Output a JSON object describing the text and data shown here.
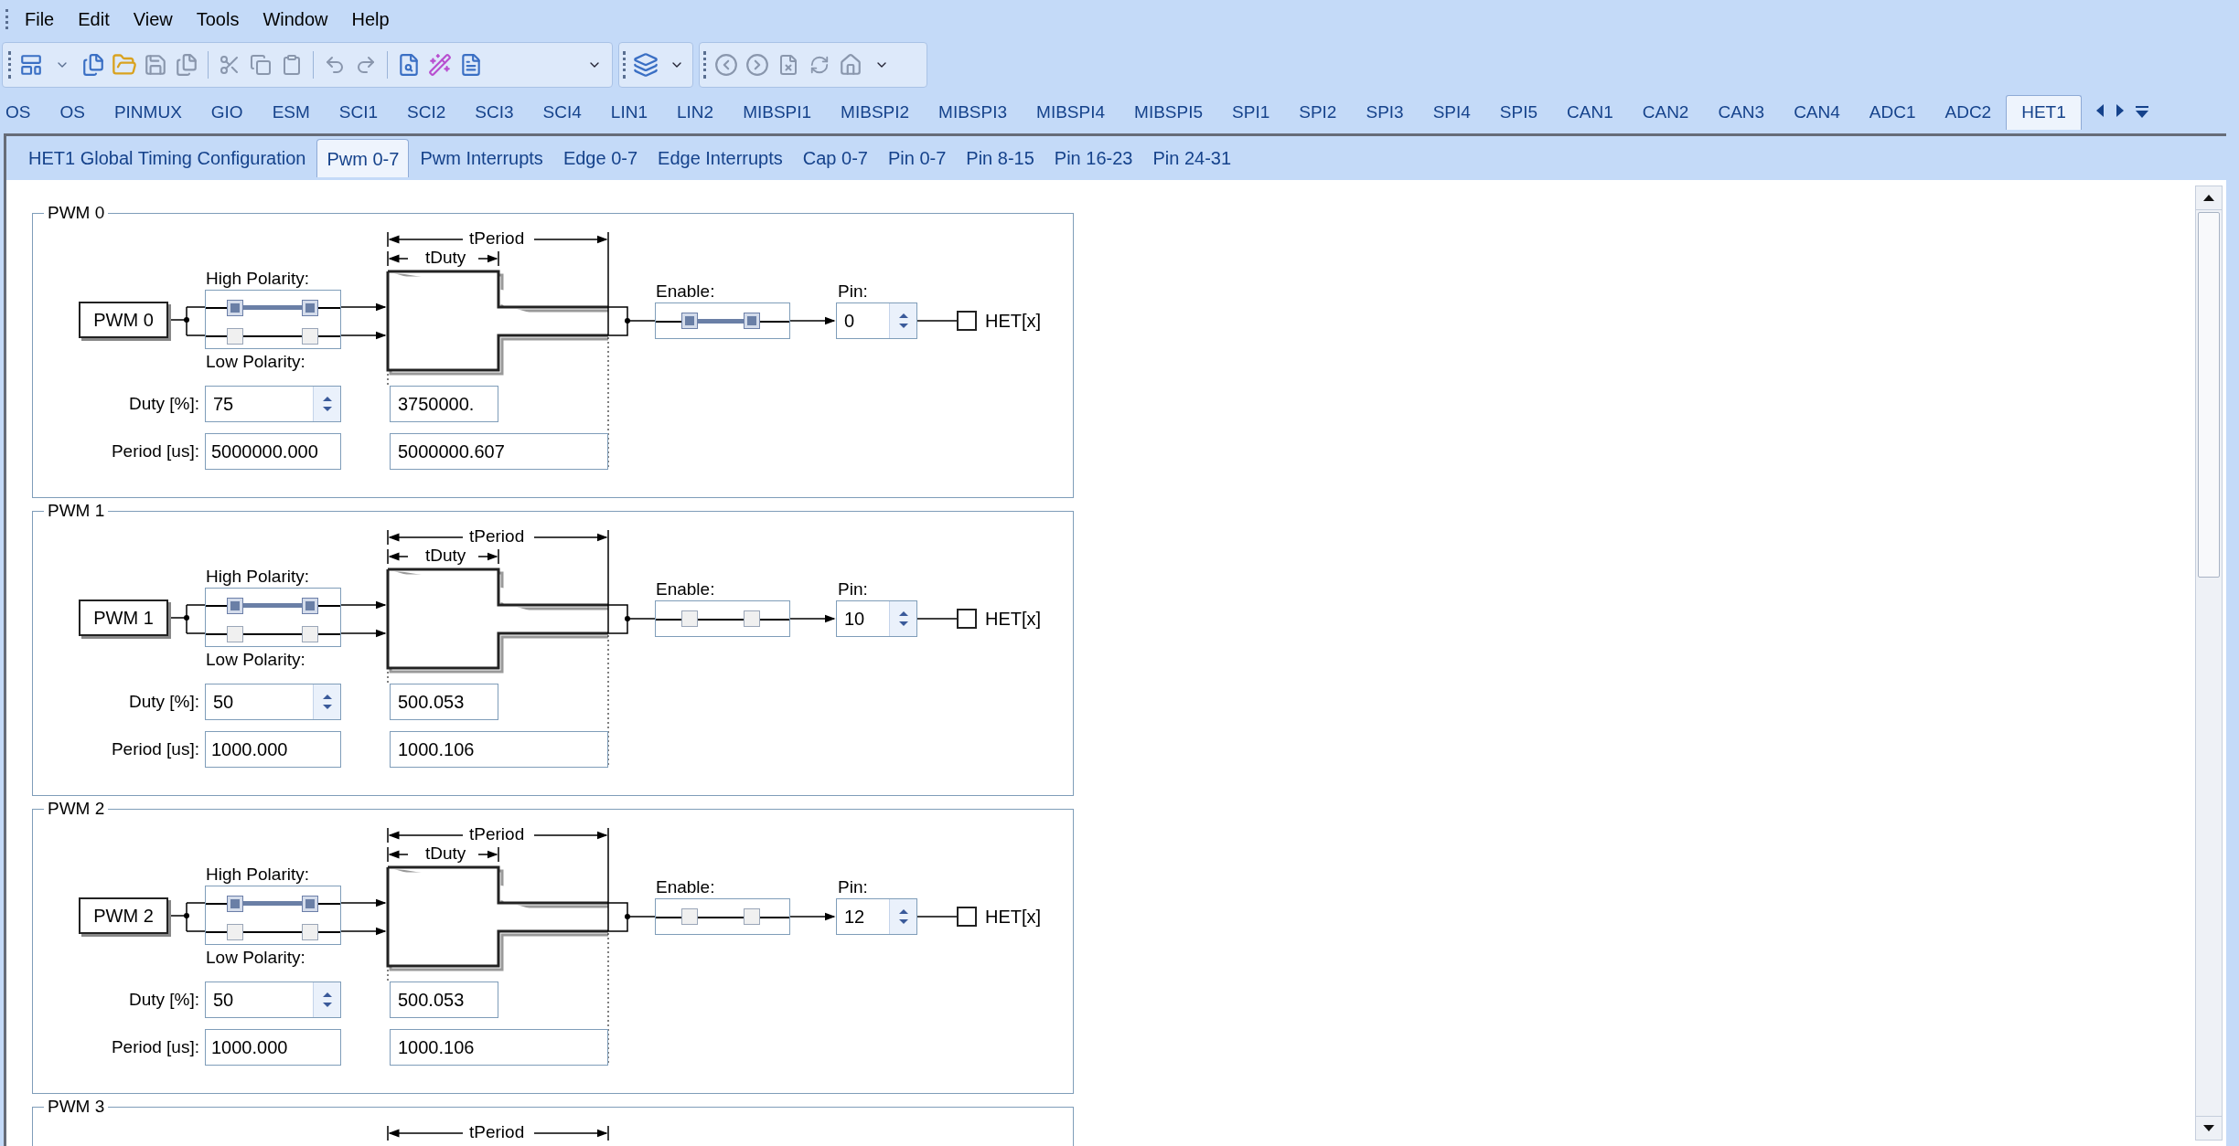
{
  "menu": [
    "File",
    "Edit",
    "View",
    "Tools",
    "Window",
    "Help"
  ],
  "module_tabs": [
    {
      "label": "OS",
      "selected": false
    },
    {
      "label": "OS",
      "selected": false
    },
    {
      "label": "PINMUX",
      "selected": false
    },
    {
      "label": "GIO",
      "selected": false
    },
    {
      "label": "ESM",
      "selected": false
    },
    {
      "label": "SCI1",
      "selected": false
    },
    {
      "label": "SCI2",
      "selected": false
    },
    {
      "label": "SCI3",
      "selected": false
    },
    {
      "label": "SCI4",
      "selected": false
    },
    {
      "label": "LIN1",
      "selected": false
    },
    {
      "label": "LIN2",
      "selected": false
    },
    {
      "label": "MIBSPI1",
      "selected": false
    },
    {
      "label": "MIBSPI2",
      "selected": false
    },
    {
      "label": "MIBSPI3",
      "selected": false
    },
    {
      "label": "MIBSPI4",
      "selected": false
    },
    {
      "label": "MIBSPI5",
      "selected": false
    },
    {
      "label": "SPI1",
      "selected": false
    },
    {
      "label": "SPI2",
      "selected": false
    },
    {
      "label": "SPI3",
      "selected": false
    },
    {
      "label": "SPI4",
      "selected": false
    },
    {
      "label": "SPI5",
      "selected": false
    },
    {
      "label": "CAN1",
      "selected": false
    },
    {
      "label": "CAN2",
      "selected": false
    },
    {
      "label": "CAN3",
      "selected": false
    },
    {
      "label": "CAN4",
      "selected": false
    },
    {
      "label": "ADC1",
      "selected": false
    },
    {
      "label": "ADC2",
      "selected": false
    },
    {
      "label": "HET1",
      "selected": true
    }
  ],
  "sub_tabs": [
    {
      "label": "HET1 Global Timing Configuration",
      "selected": false
    },
    {
      "label": "Pwm 0-7",
      "selected": true
    },
    {
      "label": "Pwm Interrupts",
      "selected": false
    },
    {
      "label": "Edge 0-7",
      "selected": false
    },
    {
      "label": "Edge Interrupts",
      "selected": false
    },
    {
      "label": "Cap 0-7",
      "selected": false
    },
    {
      "label": "Pin 0-7",
      "selected": false
    },
    {
      "label": "Pin 8-15",
      "selected": false
    },
    {
      "label": "Pin 16-23",
      "selected": false
    },
    {
      "label": "Pin 24-31",
      "selected": false
    }
  ],
  "pwm_groups": [
    {
      "title": "PWM 0",
      "source": "PWM 0",
      "tperiod_label": "tPeriod",
      "tduty_label": "tDuty",
      "high_polarity_label": "High Polarity:",
      "low_polarity_label": "Low Polarity:",
      "high_polarity": true,
      "enable_label": "Enable:",
      "enabled": true,
      "pin_label": "Pin:",
      "pin": "0",
      "output_checked": false,
      "output_label": "HET[x]",
      "duty_label": "Duty [%]:",
      "duty": "75",
      "period_label": "Period [us]:",
      "period": "5000000.000",
      "tduty_value": "3750000.",
      "tperiod_value": "5000000.607"
    },
    {
      "title": "PWM 1",
      "source": "PWM 1",
      "tperiod_label": "tPeriod",
      "tduty_label": "tDuty",
      "high_polarity_label": "High Polarity:",
      "low_polarity_label": "Low Polarity:",
      "high_polarity": true,
      "enable_label": "Enable:",
      "enabled": false,
      "pin_label": "Pin:",
      "pin": "10",
      "output_checked": false,
      "output_label": "HET[x]",
      "duty_label": "Duty [%]:",
      "duty": "50",
      "period_label": "Period [us]:",
      "period": "1000.000",
      "tduty_value": "500.053",
      "tperiod_value": "1000.106"
    },
    {
      "title": "PWM 2",
      "source": "PWM 2",
      "tperiod_label": "tPeriod",
      "tduty_label": "tDuty",
      "high_polarity_label": "High Polarity:",
      "low_polarity_label": "Low Polarity:",
      "high_polarity": true,
      "enable_label": "Enable:",
      "enabled": false,
      "pin_label": "Pin:",
      "pin": "12",
      "output_checked": false,
      "output_label": "HET[x]",
      "duty_label": "Duty [%]:",
      "duty": "50",
      "period_label": "Period [us]:",
      "period": "1000.000",
      "tduty_value": "500.053",
      "tperiod_value": "1000.106"
    },
    {
      "title": "PWM 3",
      "tperiod_label": "tPeriod"
    }
  ]
}
